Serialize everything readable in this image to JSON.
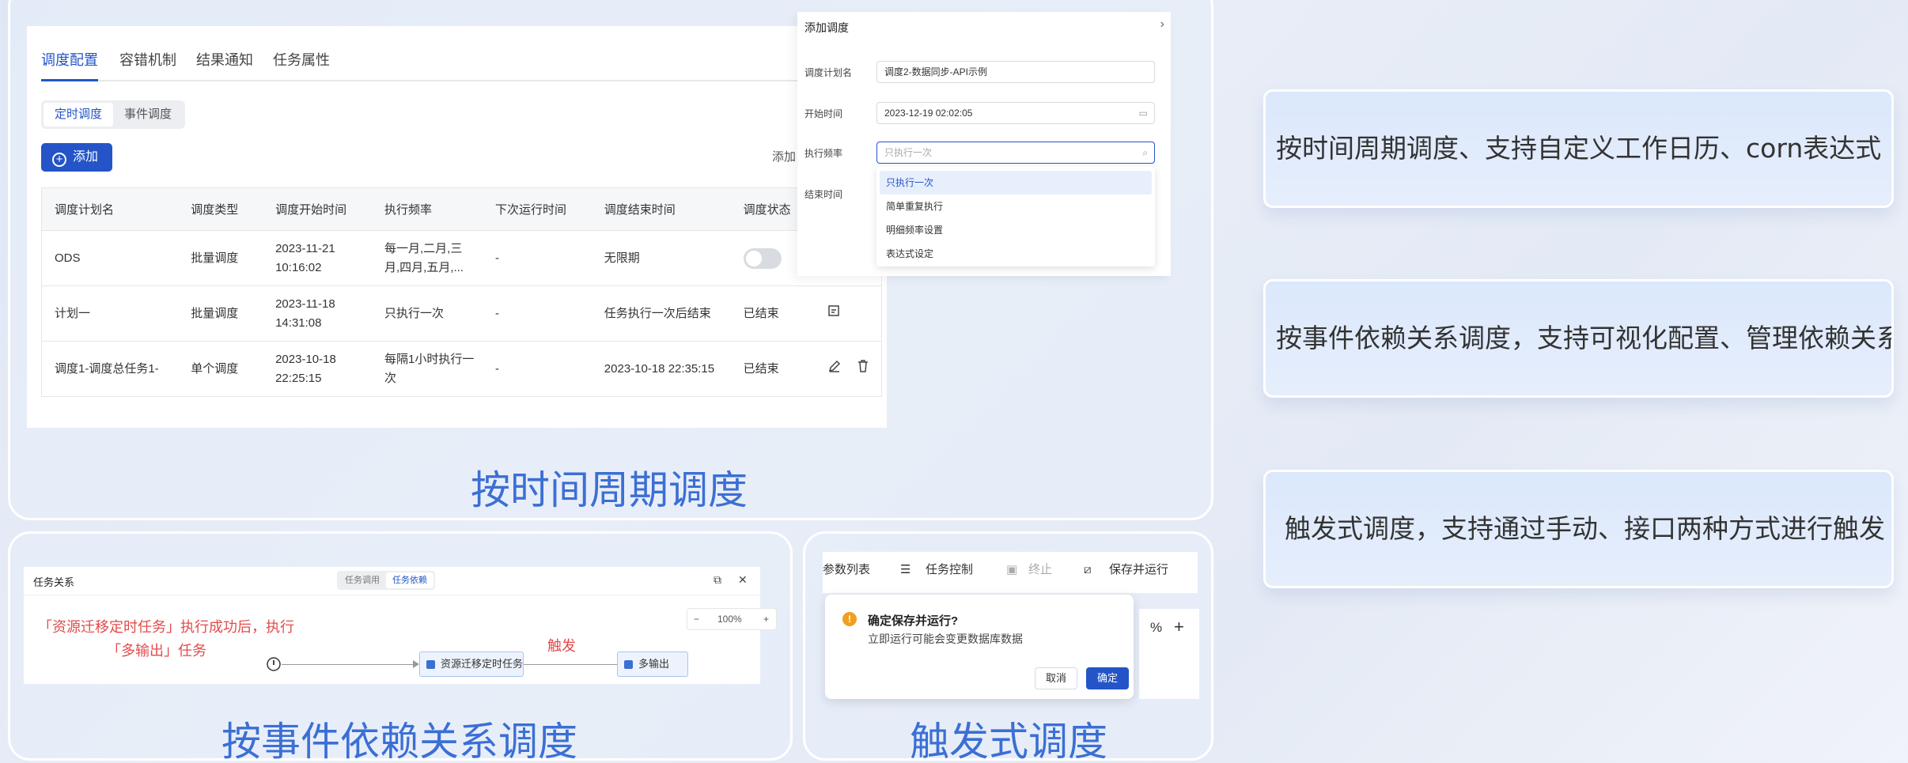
{
  "schedule_panel": {
    "title": "按时间周期调度",
    "tabs": [
      "调度配置",
      "容错机制",
      "结果通知",
      "任务属性"
    ],
    "mode_tabs": [
      "定时调度",
      "事件调度"
    ],
    "add_button": "添加",
    "add_link": "添加",
    "table": {
      "columns": [
        "调度计划名",
        "调度类型",
        "调度开始时间",
        "执行频率",
        "下次运行时间",
        "调度结束时间",
        "调度状态"
      ],
      "rows": [
        {
          "name": "ODS",
          "type": "批量调度",
          "start": "2023-11-21 10:16:02",
          "freq": "每一月,二月,三月,四月,五月,...",
          "next": "-",
          "end": "无限期",
          "status": ""
        },
        {
          "name": "计划一",
          "type": "批量调度",
          "start": "2023-11-18 14:31:08",
          "freq": "只执行一次",
          "next": "-",
          "end": "任务执行一次后结束",
          "status": "已结束"
        },
        {
          "name": "调度1-调度总任务1-",
          "type": "单个调度",
          "start": "2023-10-18 22:25:15",
          "freq": "每隔1小时执行一次",
          "next": "-",
          "end": "2023-10-18 22:35:15",
          "status": "已结束"
        }
      ]
    },
    "dialog": {
      "title": "添加调度",
      "fields": [
        {
          "label": "调度计划名",
          "value": "调度2-数据同步-API示例"
        },
        {
          "label": "开始时间",
          "value": "2023-12-19 02:02:05"
        },
        {
          "label": "执行频率",
          "value": "只执行一次"
        },
        {
          "label": "结束时间",
          "value": ""
        }
      ],
      "dropdown_options": [
        "只执行一次",
        "简单重复执行",
        "明细频率设置",
        "表达式设定"
      ]
    }
  },
  "feature_cards": [
    "按时间周期调度、支持自定义工作日历、corn表达式",
    "按事件依赖关系调度，支持可视化配置、管理依赖关系",
    "触发式调度，支持通过手动、接口两种方式进行触发"
  ],
  "dependency_panel": {
    "title": "按事件依赖关系调度",
    "header_title": "任务关系",
    "tabs": [
      "任务调用",
      "任务依赖"
    ],
    "note_line1": "「资源迁移定时任务」执行成功后，执行",
    "note_line2": "「多输出」任务",
    "trigger_label": "触发",
    "zoom_value": "100%",
    "node1": "资源迁移定时任务",
    "node2": "多输出"
  },
  "trigger_panel": {
    "title": "触发式调度",
    "toolbar": [
      "参数列表",
      "任务控制",
      "终止",
      "保存并运行"
    ],
    "confirm_title": "确定保存并运行?",
    "confirm_desc": "立即运行可能会变更数据库数据",
    "cancel": "取消",
    "ok": "确定",
    "zoom_fragment": "%"
  },
  "colors": {
    "accent": "#2454c8",
    "title_blue": "#3b6fd4",
    "red_note": "#e24b4b"
  }
}
